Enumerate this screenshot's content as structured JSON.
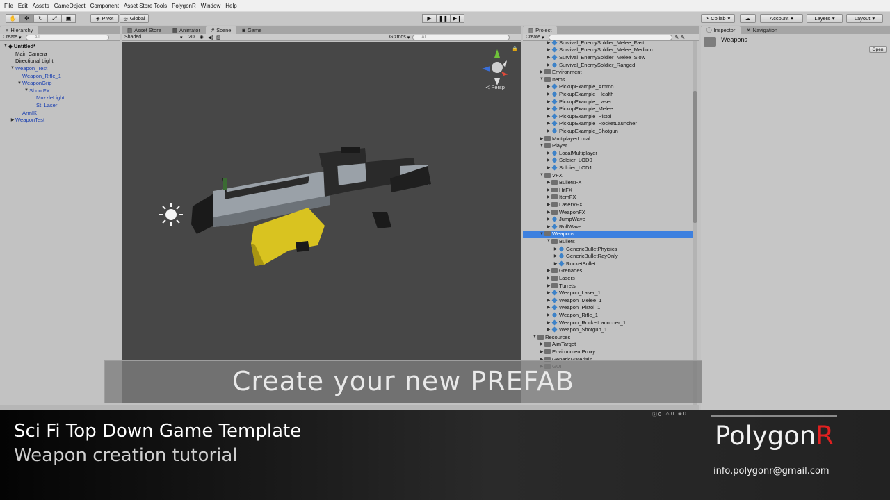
{
  "menu": [
    "File",
    "Edit",
    "Assets",
    "GameObject",
    "Component",
    "Asset Store Tools",
    "PolygonR",
    "Window",
    "Help"
  ],
  "toolbar": {
    "pivot": "Pivot",
    "global": "Global",
    "collab": "Collab",
    "account": "Account",
    "layers": "Layers",
    "layout": "Layout"
  },
  "hierarchy": {
    "tab": "Hierarchy",
    "create": "Create",
    "search_placeholder": "All",
    "scene": "Untitled*",
    "items": [
      {
        "label": "Main Camera",
        "indent": 0,
        "arrow": ""
      },
      {
        "label": "Directional Light",
        "indent": 0,
        "arrow": ""
      },
      {
        "label": "Weapon_Test",
        "indent": 0,
        "arrow": "▼",
        "blue": true
      },
      {
        "label": "Weapon_Rifle_1",
        "indent": 1,
        "arrow": "",
        "blue": true
      },
      {
        "label": "WeaponGrip",
        "indent": 1,
        "arrow": "▼",
        "blue": true
      },
      {
        "label": "ShootFX",
        "indent": 2,
        "arrow": "▼",
        "blue": true
      },
      {
        "label": "MuzzleLight",
        "indent": 3,
        "arrow": "",
        "blue": true
      },
      {
        "label": "St_Laser",
        "indent": 3,
        "arrow": "",
        "blue": true
      },
      {
        "label": "ArmIK",
        "indent": 1,
        "arrow": "",
        "blue": true
      },
      {
        "label": "WeaponTest",
        "indent": 0,
        "arrow": "▶",
        "blue": true
      }
    ]
  },
  "scene_tabs": [
    "Asset Store",
    "Animator",
    "Scene",
    "Game"
  ],
  "scene_active_tab": "Scene",
  "scene_toolbar": {
    "shading": "Shaded",
    "mode2d": "2D",
    "gizmos": "Gizmos",
    "search": "All"
  },
  "scene_persp": "Persp",
  "project": {
    "tab": "Project",
    "create": "Create",
    "items": [
      {
        "label": "Survival_EnemySoldier_Melee_Fast",
        "indent": 2,
        "type": "prefab"
      },
      {
        "label": "Survival_EnemySoldier_Melee_Medium",
        "indent": 2,
        "type": "prefab"
      },
      {
        "label": "Survival_EnemySoldier_Melee_Slow",
        "indent": 2,
        "type": "prefab"
      },
      {
        "label": "Survival_EnemySoldier_Ranged",
        "indent": 2,
        "type": "prefab"
      },
      {
        "label": "Environment",
        "indent": 1,
        "type": "folder"
      },
      {
        "label": "Items",
        "indent": 1,
        "type": "folder",
        "open": true
      },
      {
        "label": "PickupExample_Ammo",
        "indent": 2,
        "type": "prefab"
      },
      {
        "label": "PickupExample_Health",
        "indent": 2,
        "type": "prefab"
      },
      {
        "label": "PickupExample_Laser",
        "indent": 2,
        "type": "prefab"
      },
      {
        "label": "PickupExample_Melee",
        "indent": 2,
        "type": "prefab"
      },
      {
        "label": "PickupExample_Pistol",
        "indent": 2,
        "type": "prefab"
      },
      {
        "label": "PickupExample_RocketLauncher",
        "indent": 2,
        "type": "prefab"
      },
      {
        "label": "PickupExample_Shotgun",
        "indent": 2,
        "type": "prefab"
      },
      {
        "label": "MultiplayerLocal",
        "indent": 1,
        "type": "folder"
      },
      {
        "label": "Player",
        "indent": 1,
        "type": "folder",
        "open": true
      },
      {
        "label": "LocalMultiplayer",
        "indent": 2,
        "type": "prefab"
      },
      {
        "label": "Soldier_LOD0",
        "indent": 2,
        "type": "prefab"
      },
      {
        "label": "Soldier_LOD1",
        "indent": 2,
        "type": "prefab"
      },
      {
        "label": "VFX",
        "indent": 1,
        "type": "folder",
        "open": true
      },
      {
        "label": "BulletsFX",
        "indent": 2,
        "type": "folder"
      },
      {
        "label": "HitFX",
        "indent": 2,
        "type": "folder"
      },
      {
        "label": "ItemFX",
        "indent": 2,
        "type": "folder"
      },
      {
        "label": "LaserVFX",
        "indent": 2,
        "type": "folder"
      },
      {
        "label": "WeaponFX",
        "indent": 2,
        "type": "folder"
      },
      {
        "label": "JumpWave",
        "indent": 2,
        "type": "prefab"
      },
      {
        "label": "RollWave",
        "indent": 2,
        "type": "prefab"
      },
      {
        "label": "Weapons",
        "indent": 1,
        "type": "folder",
        "open": true,
        "selected": true
      },
      {
        "label": "Bullets",
        "indent": 2,
        "type": "folder",
        "open": true
      },
      {
        "label": "GenericBulletPhyisics",
        "indent": 3,
        "type": "prefab"
      },
      {
        "label": "GenericBulletRayOnly",
        "indent": 3,
        "type": "prefab"
      },
      {
        "label": "RocketBullet",
        "indent": 3,
        "type": "prefab"
      },
      {
        "label": "Grenades",
        "indent": 2,
        "type": "folder"
      },
      {
        "label": "Lasers",
        "indent": 2,
        "type": "folder"
      },
      {
        "label": "Turrets",
        "indent": 2,
        "type": "folder"
      },
      {
        "label": "Weapon_Laser_1",
        "indent": 2,
        "type": "prefab"
      },
      {
        "label": "Weapon_Melee_1",
        "indent": 2,
        "type": "prefab"
      },
      {
        "label": "Weapon_Pistol_1",
        "indent": 2,
        "type": "prefab"
      },
      {
        "label": "Weapon_Rifle_1",
        "indent": 2,
        "type": "prefab"
      },
      {
        "label": "Weapon_RocketLauncher_1",
        "indent": 2,
        "type": "prefab"
      },
      {
        "label": "Weapon_Shotgun_1",
        "indent": 2,
        "type": "prefab"
      },
      {
        "label": "Resources",
        "indent": 0,
        "type": "folder",
        "open": true
      },
      {
        "label": "AimTarget",
        "indent": 1,
        "type": "folder"
      },
      {
        "label": "EnvironmentProxy",
        "indent": 1,
        "type": "folder"
      },
      {
        "label": "GenericMaterials",
        "indent": 1,
        "type": "folder"
      },
      {
        "label": "GUI",
        "indent": 1,
        "type": "folder"
      }
    ]
  },
  "inspector": {
    "tab_inspector": "Inspector",
    "tab_navigation": "Navigation",
    "asset_name": "Weapons",
    "open_button": "Open"
  },
  "caption": "Create your new PREFAB",
  "title1": "Sci Fi Top Down Game Template",
  "title2": "Weapon creation tutorial",
  "logo_main": "Polygon",
  "logo_accent": "R",
  "email": "info.polygonr@gmail.com",
  "console_counts": [
    "0",
    "0",
    "0"
  ]
}
